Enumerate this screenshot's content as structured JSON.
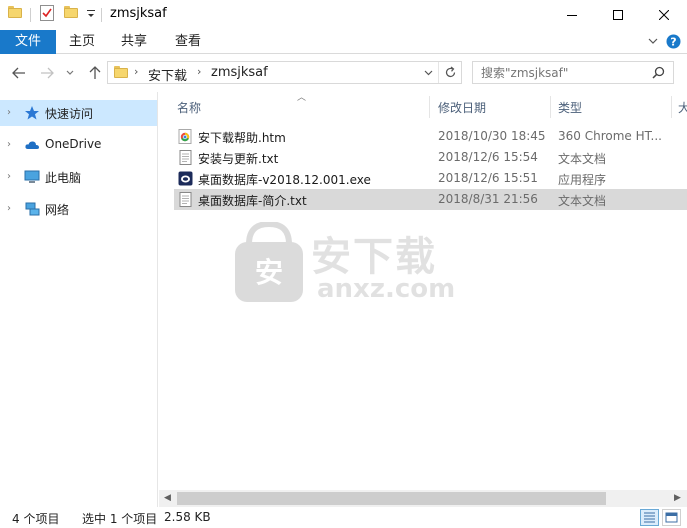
{
  "window": {
    "title": "zmsjksaf"
  },
  "ribbon": {
    "tabs": [
      "文件",
      "主页",
      "共享",
      "查看"
    ]
  },
  "address": {
    "crumbs": [
      "安下载",
      "zmsjksaf"
    ],
    "search_placeholder": "搜索\"zmsjksaf\""
  },
  "sidebar": {
    "items": [
      {
        "label": "快速访问",
        "icon": "star-icon"
      },
      {
        "label": "OneDrive",
        "icon": "cloud-icon"
      },
      {
        "label": "此电脑",
        "icon": "computer-icon"
      },
      {
        "label": "网络",
        "icon": "network-icon"
      }
    ]
  },
  "columns": {
    "name": "名称",
    "date": "修改日期",
    "type": "类型",
    "size": "大"
  },
  "files": [
    {
      "name": "安下载帮助.htm",
      "date": "2018/10/30 18:45",
      "type": "360 Chrome HT...",
      "icon": "browser-file-icon"
    },
    {
      "name": "安装与更新.txt",
      "date": "2018/12/6 15:54",
      "type": "文本文档",
      "icon": "text-file-icon"
    },
    {
      "name": "桌面数据库-v2018.12.001.exe",
      "date": "2018/12/6 15:51",
      "type": "应用程序",
      "icon": "exe-file-icon"
    },
    {
      "name": "桌面数据库-简介.txt",
      "date": "2018/8/31 21:56",
      "type": "文本文档",
      "icon": "text-file-icon"
    }
  ],
  "watermark": {
    "cn": "安下载",
    "en": "anxz.com"
  },
  "status": {
    "count": "4 个项目",
    "selected": "选中 1 个项目",
    "size": "2.58 KB"
  },
  "colors": {
    "accent": "#1979ca",
    "selection": "#cce8ff",
    "row_selected": "#d9d9d9",
    "folder": "#f6d66d"
  }
}
